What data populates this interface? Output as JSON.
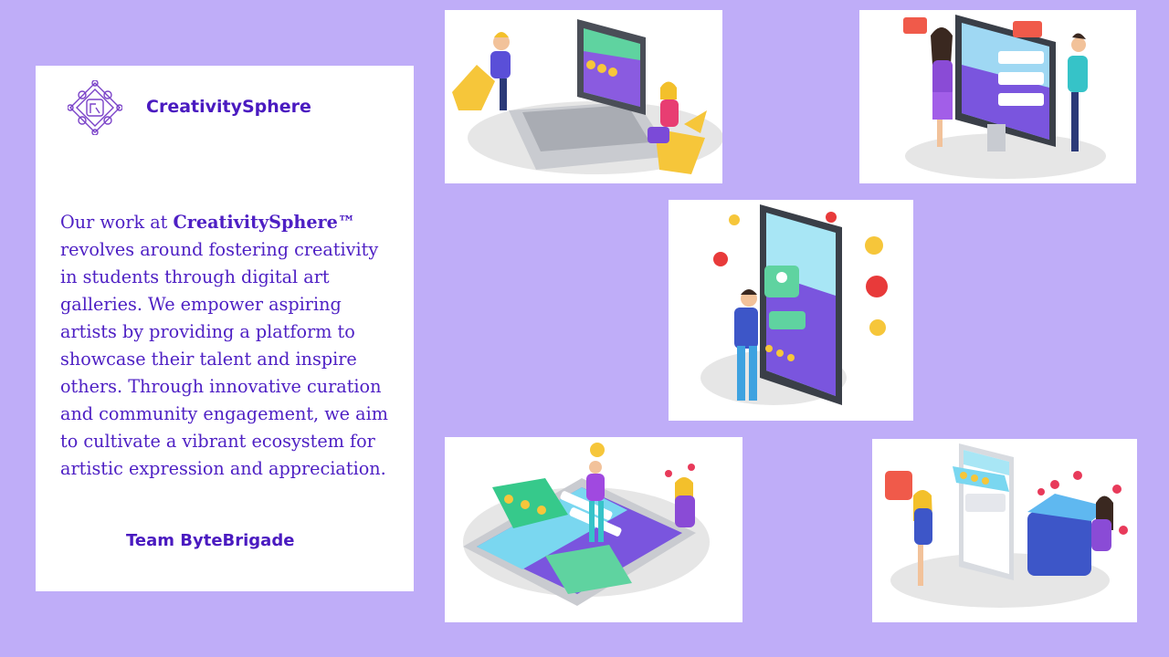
{
  "brand": {
    "name": "CreativitySphere",
    "logo_icon": "ornamental-frame-icon"
  },
  "description": {
    "before": "Our work at ",
    "brand_mark": "CreativitySphere™",
    "after": " revolves around fostering creativity in students through digital art galleries. We empower aspiring artists by providing a platform to showcase their talent and inspire others. Through innovative curation and community engagement, we aim to cultivate a vibrant ecosystem for artistic expression and appreciation."
  },
  "team": "Team ByteBrigade",
  "colors": {
    "background": "#bfadf8",
    "brand_purple": "#4a1ac0",
    "card": "#ffffff"
  },
  "illustrations": [
    "laptop-review-illustration",
    "monitor-feedback-illustration",
    "tablet-rating-illustration",
    "tablet-chat-illustration",
    "phone-likes-illustration"
  ]
}
